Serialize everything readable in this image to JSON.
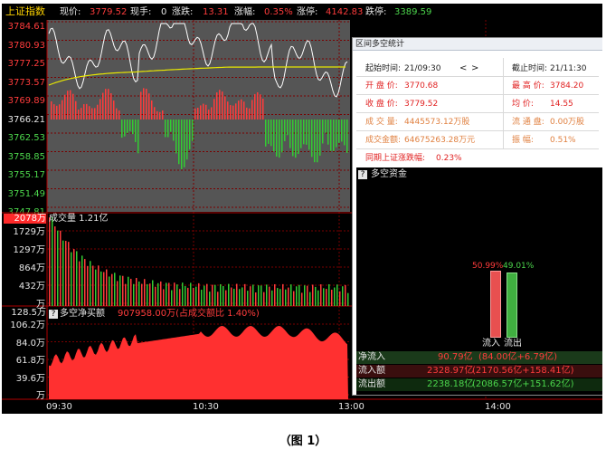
{
  "header": {
    "index_name": "上证指数",
    "price_label": "现价:",
    "price": "3779.52",
    "volume_label": "现手:",
    "volume": "0",
    "change_label": "涨跌:",
    "change": "13.31",
    "pct_label": "涨幅:",
    "pct": "0.35%",
    "limit_up_label": "涨停:",
    "limit_up": "4142.83",
    "limit_down_label": "跌停:",
    "limit_down": "3389.59"
  },
  "price_axis": [
    "3784.61",
    "3780.93",
    "3777.25",
    "3773.57",
    "3769.89",
    "3766.21",
    "3762.53",
    "3758.85",
    "3755.17",
    "3751.49",
    "3747.81"
  ],
  "volume_panel": {
    "badge": "2078万",
    "title": "成交量 1.21亿",
    "axis": [
      "1729万",
      "1297万",
      "864万",
      "432万",
      "万"
    ]
  },
  "netbuy_panel": {
    "badge": "128.5万",
    "title": "多空净买额",
    "value": "907958.00万(占成交额比 1.40%)",
    "axis": [
      "106.2万",
      "84.0万",
      "61.8万",
      "39.6万",
      "万"
    ]
  },
  "time_axis": [
    "09:30",
    "10:30",
    "13:00",
    "14:00"
  ],
  "dialog": {
    "title": "区间多空统计",
    "start_label": "起始时间:",
    "start_time": "21/09:30",
    "end_label": "截止时间:",
    "end_time": "21/11:30",
    "prev_arrow": "<",
    "next_arrow": ">",
    "open_label": "开 盘 价:",
    "open": "3770.68",
    "high_label": "最 高 价:",
    "high": "3784.20",
    "close_label": "收 盘 价:",
    "close": "3779.52",
    "avg_label": "均  价:",
    "avg": "14.55",
    "vol_label": "成 交 量:",
    "vol": "4445573.12万股",
    "float_label": "流 通 盘:",
    "float": "0.00万股",
    "amount_label": "成交金额:",
    "amount": "64675263.28万元",
    "swing_label": "振  幅:",
    "swing": "0.51%",
    "sync_label": "同期上证涨跌幅:",
    "sync": "0.23%",
    "capital_title": "多空资金",
    "inflow_pct": "50.99%",
    "outflow_pct": "49.01%",
    "inflow_bar_label": "流入",
    "outflow_bar_label": "流出",
    "net_label": "净流入",
    "net_value": "90.79亿",
    "net_detail": "(84.00亿+6.79亿)",
    "in_label": "流入额",
    "in_value": "2328.97亿",
    "in_detail": "(2170.56亿+158.41亿)",
    "out_label": "流出额",
    "out_value": "2238.18亿",
    "out_detail": "(2086.57亿+151.62亿)"
  },
  "caption": "（图 1）",
  "colors": {
    "up": "#ff3c3c",
    "down": "#33cc33",
    "avg_line": "#e8e800",
    "price_line": "#ffffff",
    "grid": "#7a0000",
    "panel_bg": "#555555"
  }
}
